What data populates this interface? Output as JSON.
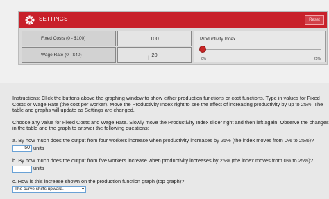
{
  "settings": {
    "title": "SETTINGS",
    "reset_label": "Reset",
    "fixed_costs_label": "Fixed Costs (0 - $100)",
    "fixed_costs_value": "100",
    "wage_rate_label": "Wage Rate (0 - $40)",
    "wage_rate_value": "20",
    "productivity_title": "Productivity Index",
    "slider_min": "0%",
    "slider_max": "25%",
    "slider_value_fraction": 0
  },
  "instructions": {
    "p1": "Instructions: Click the buttons above the graphing window to show either production functions or cost functions. Type in values for Fixed Costs or Wage Rate (the cost per worker). Move the Productivity Index right to see the effect of increasing productivity by up to 25%. The table and graphs will update as Settings are changed.",
    "p2": "Choose any value for Fixed Costs and Wage Rate. Slowly move the Productivity Index slider right and then left again. Observe the changes in the table and the graph to answer the following questions:"
  },
  "questions": [
    {
      "text": "a. By how much does the output from four workers increase when productivity increases by 25% (the index moves from 0% to 25%)?",
      "answer": "50",
      "unit": "units"
    },
    {
      "text": "b. By how much does the output from five workers increase when productivity increases by 25% (the index moves from 0% to 25%)?",
      "answer": "",
      "unit": "units"
    },
    {
      "text": "c. How is this increase shown on the production function graph (top graph)?",
      "selected": "The curve shifts upward."
    }
  ],
  "colors": {
    "settings_bar": "#c8202a",
    "slider_thumb": "#c82727",
    "input_border": "#6aa2d6"
  }
}
